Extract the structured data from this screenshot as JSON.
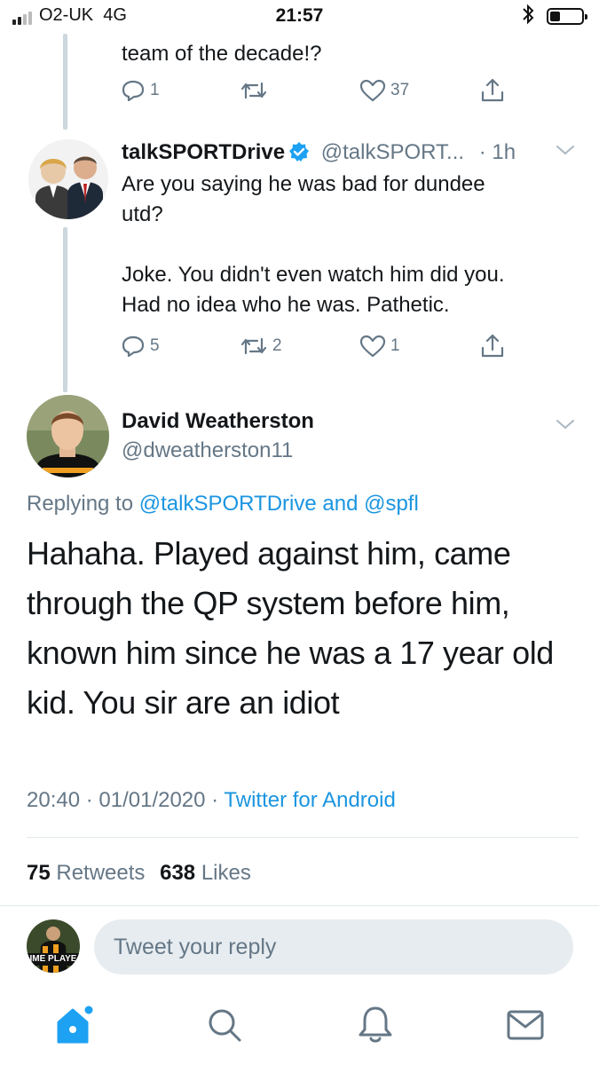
{
  "status_bar": {
    "carrier": "O2-UK  4G",
    "time": "21:57"
  },
  "prev_tweet": {
    "text_tail": "team of the decade!?",
    "replies": "1",
    "retweets": "",
    "likes": "37"
  },
  "talksport_tweet": {
    "name": "talkSPORTDrive",
    "handle": "@talkSPORT...",
    "time": "· 1h",
    "text_line1": "Are you saying he was bad for dundee",
    "text_line2": "utd?",
    "text_line3": "Joke. You didn't even watch him did you.",
    "text_line4": "Had no idea who he was. Pathetic.",
    "replies": "5",
    "retweets": "2",
    "likes": "1"
  },
  "main_tweet": {
    "name": "David Weatherston",
    "handle": "@dweatherston11",
    "replying_prefix": "Replying to",
    "replying_to": "@talkSPORTDrive and @spfl",
    "text_line1": "Hahaha. Played against him, came",
    "text_line2": "through the QP system before him,",
    "text_line3": "known him since he was a 17 year old",
    "text_line4": "kid. You sir are an idiot",
    "timestamp": "20:40 · 01/01/2020 ·",
    "source": "Twitter for Android",
    "retweet_count": "75",
    "retweet_label": "Retweets",
    "like_count": "638",
    "like_label": "Likes"
  },
  "reply_bar": {
    "placeholder": "Tweet your reply",
    "avatar_text": "IME PLAYE"
  },
  "tab_bar": {
    "icons": [
      "home-icon",
      "search-icon",
      "notifications-icon",
      "messages-icon"
    ]
  },
  "colors": {
    "accent": "#1da1f2",
    "link": "#1b95e0",
    "secondary_text": "#657786",
    "divider": "#e1e8ed"
  }
}
